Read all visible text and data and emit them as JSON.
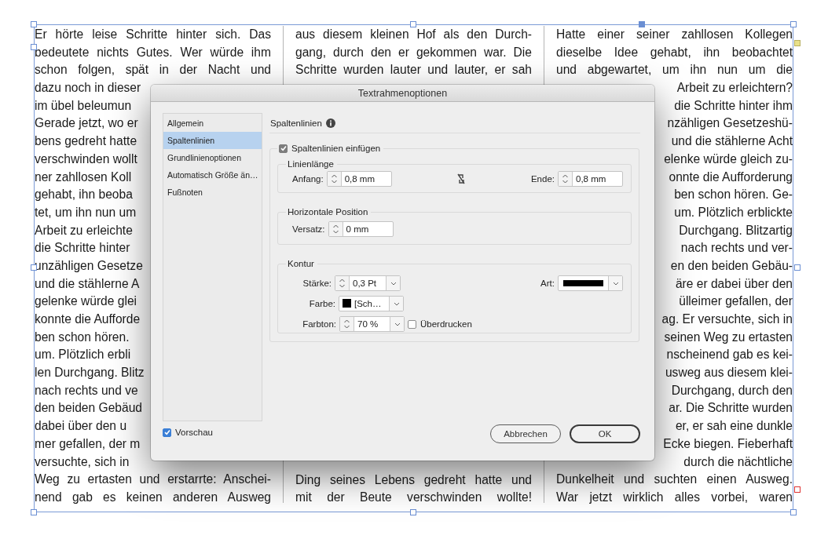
{
  "document": {
    "columns": [
      {
        "lines_top": [
          {
            "text": "Er hörte leise Schritte hinter sich. Das",
            "covered": false
          },
          {
            "text": "bedeutete nichts Gutes. Wer würde ihm",
            "covered": false
          },
          {
            "text": "schon folgen, spät in der Nacht und",
            "covered": false
          },
          {
            "text": "dazu noch in dieser",
            "covered": true
          },
          {
            "text": "im übel beleumun",
            "covered": true
          },
          {
            "text": "Gerade jetzt, wo er",
            "covered": true
          },
          {
            "text": "bens gedreht hatte",
            "covered": true
          },
          {
            "text": "verschwinden wollt",
            "covered": true
          },
          {
            "text": "ner zahllosen Koll",
            "covered": true
          },
          {
            "text": "gehabt, ihn beoba",
            "covered": true
          },
          {
            "text": "tet, um ihn nun um",
            "covered": true
          },
          {
            "text": "Arbeit zu erleichte",
            "covered": true
          },
          {
            "text": "die Schritte hinter",
            "covered": true
          },
          {
            "text": "unzähligen Gesetze",
            "covered": true
          },
          {
            "text": "und die stählerne A",
            "covered": true
          },
          {
            "text": "gelenke würde glei",
            "covered": true
          },
          {
            "text": "konnte die Aufforde",
            "covered": true
          },
          {
            "text": "ben schon hören.",
            "covered": true
          },
          {
            "text": "um. Plötzlich erbli",
            "covered": true
          },
          {
            "text": "len Durchgang. Blitz",
            "covered": true
          },
          {
            "text": "nach rechts und ve",
            "covered": true
          },
          {
            "text": "den beiden Gebäud",
            "covered": true
          },
          {
            "text": "dabei über den u",
            "covered": true
          },
          {
            "text": "mer gefallen, der m",
            "covered": true
          },
          {
            "text": "versuchte, sich in",
            "covered": true
          },
          {
            "text": "Weg zu ertasten und erstarrte: Anschei-",
            "covered": false
          },
          {
            "text": "nend gab es keinen anderen Ausweg",
            "covered": false
          }
        ]
      },
      {
        "lines_top": [
          {
            "text": "aus diesem kleinen Hof als den Durch-",
            "covered": false
          },
          {
            "text": "gang, durch den er gekommen war. Die",
            "covered": false
          },
          {
            "text": "Schritte wurden lauter und lauter, er sah",
            "covered": false
          }
        ],
        "lines_bottom": [
          {
            "text": "Ding seines Lebens gedreht hatte und",
            "covered": false
          },
          {
            "text": "mit der Beute verschwinden wollte!",
            "covered": false
          }
        ]
      },
      {
        "lines_top": [
          {
            "text": "Hatte einer seiner zahllosen Kollegen",
            "covered": false
          },
          {
            "text": "dieselbe Idee gehabt, ihn beobachtet",
            "covered": false
          },
          {
            "text": "und abgewartet, um ihn nun um die",
            "covered": false
          },
          {
            "text": "Arbeit zu erleichtern?",
            "covered": true
          },
          {
            "text": "die Schritte hinter ihm",
            "covered": true
          },
          {
            "text": "nzähligen Gesetzeshü-",
            "covered": true
          },
          {
            "text": "und die stählerne Acht",
            "covered": true
          },
          {
            "text": "elenke würde gleich zu-",
            "covered": true
          },
          {
            "text": "onnte die Aufforderung",
            "covered": true
          },
          {
            "text": "ben schon hören. Ge-",
            "covered": true
          },
          {
            "text": "um. Plötzlich erblickte",
            "covered": true
          },
          {
            "text": "Durchgang. Blitzartig",
            "covered": true
          },
          {
            "text": "nach rechts und ver-",
            "covered": true
          },
          {
            "text": "en den beiden Gebäu-",
            "covered": true
          },
          {
            "text": "äre er dabei über den",
            "covered": true
          },
          {
            "text": "ülleimer gefallen, der",
            "covered": true
          },
          {
            "text": "ag. Er versuchte, sich in",
            "covered": true
          },
          {
            "text": "seinen Weg zu ertasten",
            "covered": true
          },
          {
            "text": "nscheinend gab es kei-",
            "covered": true
          },
          {
            "text": "usweg aus diesem klei-",
            "covered": true
          },
          {
            "text": "Durchgang, durch den",
            "covered": true
          },
          {
            "text": "ar. Die Schritte wurden",
            "covered": true
          },
          {
            "text": "er, er sah eine dunkle",
            "covered": true
          },
          {
            "text": "Ecke biegen. Fieberhaft",
            "covered": true
          },
          {
            "text": "durch die nächtliche",
            "covered": true
          },
          {
            "text": "Dunkelheit und suchten einen Ausweg.",
            "covered": false
          },
          {
            "text": "War jetzt wirklich alles vorbei, waren",
            "covered": false
          }
        ]
      }
    ]
  },
  "dialog": {
    "title": "Textrahmenoptionen",
    "sidebar": [
      {
        "label": "Allgemein",
        "selected": false
      },
      {
        "label": "Spaltenlinien",
        "selected": true
      },
      {
        "label": "Grundlinienoptionen",
        "selected": false
      },
      {
        "label": "Automatisch Größe än…",
        "selected": false
      },
      {
        "label": "Fußnoten",
        "selected": false
      }
    ],
    "preview": {
      "label": "Vorschau",
      "checked": true
    },
    "section_title": "Spaltenlinien",
    "insert": {
      "label": "Spaltenlinien einfügen",
      "checked": true
    },
    "line_length": {
      "title": "Linienlänge",
      "start": {
        "label": "Anfang:",
        "value": "0,8 mm"
      },
      "end": {
        "label": "Ende:",
        "value": "0,8 mm"
      }
    },
    "horizontal": {
      "title": "Horizontale Position",
      "offset": {
        "label": "Versatz:",
        "value": "0 mm"
      }
    },
    "stroke": {
      "title": "Kontur",
      "weight": {
        "label": "Stärke:",
        "value": "0,3 Pt"
      },
      "type": {
        "label": "Art:"
      },
      "color": {
        "label": "Farbe:",
        "value": "[Sch…"
      },
      "tint": {
        "label": "Farbton:",
        "value": "70 %"
      },
      "overprint": {
        "label": "Überdrucken",
        "checked": false
      }
    },
    "buttons": [
      {
        "label": "Abbrechen",
        "kind": "cancel"
      },
      {
        "label": "OK",
        "kind": "default"
      }
    ]
  }
}
